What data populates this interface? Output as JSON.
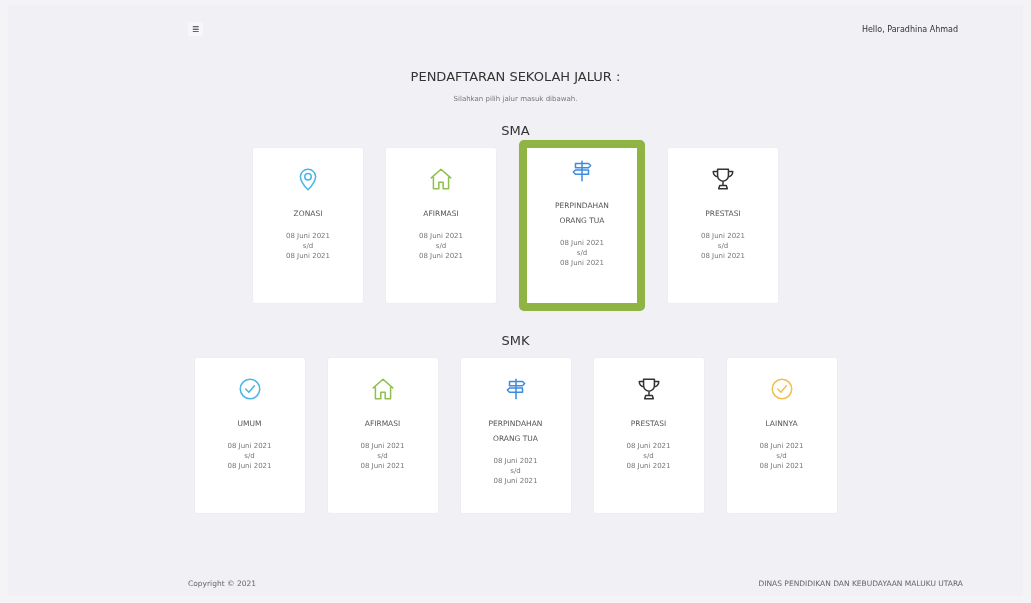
{
  "header": {
    "menu_icon": "≡",
    "greeting": "Hello, Paradhina Ahmad"
  },
  "title": "PENDAFTARAN SEKOLAH JALUR :",
  "subtitle": "Silahkan pilih jalur masuk dibawah.",
  "sections": [
    {
      "heading": "SMA",
      "cards": [
        {
          "kind": "pin",
          "label": "ZONASI",
          "dates": [
            "08 Juni 2021",
            "s/d",
            "08 Juni 2021"
          ],
          "selected": false
        },
        {
          "kind": "house",
          "label": "AFIRMASI",
          "dates": [
            "08 Juni 2021",
            "s/d",
            "08 Juni 2021"
          ],
          "selected": false
        },
        {
          "kind": "signpost",
          "label": "PERPINDAHAN ORANG TUA",
          "dates": [
            "08 Juni 2021",
            "s/d",
            "08 Juni 2021"
          ],
          "selected": true
        },
        {
          "kind": "trophy",
          "label": "PRESTASI",
          "dates": [
            "08 Juni 2021",
            "s/d",
            "08 Juni 2021"
          ],
          "selected": false
        }
      ]
    },
    {
      "heading": "SMK",
      "cards": [
        {
          "kind": "check",
          "label": "UMUM",
          "dates": [
            "08 Juni 2021",
            "s/d",
            "08 Juni 2021"
          ],
          "selected": false
        },
        {
          "kind": "house",
          "label": "AFIRMASI",
          "dates": [
            "08 Juni 2021",
            "s/d",
            "08 Juni 2021"
          ],
          "selected": false
        },
        {
          "kind": "signpost",
          "label": "PERPINDAHAN ORANG TUA",
          "dates": [
            "08 Juni 2021",
            "s/d",
            "08 Juni 2021"
          ],
          "selected": false
        },
        {
          "kind": "trophy",
          "label": "PRESTASI",
          "dates": [
            "08 Juni 2021",
            "s/d",
            "08 Juni 2021"
          ],
          "selected": false
        },
        {
          "kind": "badge",
          "label": "LAINNYA",
          "dates": [
            "08 Juni 2021",
            "s/d",
            "08 Juni 2021"
          ],
          "selected": false
        }
      ]
    }
  ],
  "footer": {
    "copyright": "Copyright © 2021",
    "agency": "DINAS PENDIDIKAN DAN KEBUDAYAAN MALUKU UTARA"
  }
}
